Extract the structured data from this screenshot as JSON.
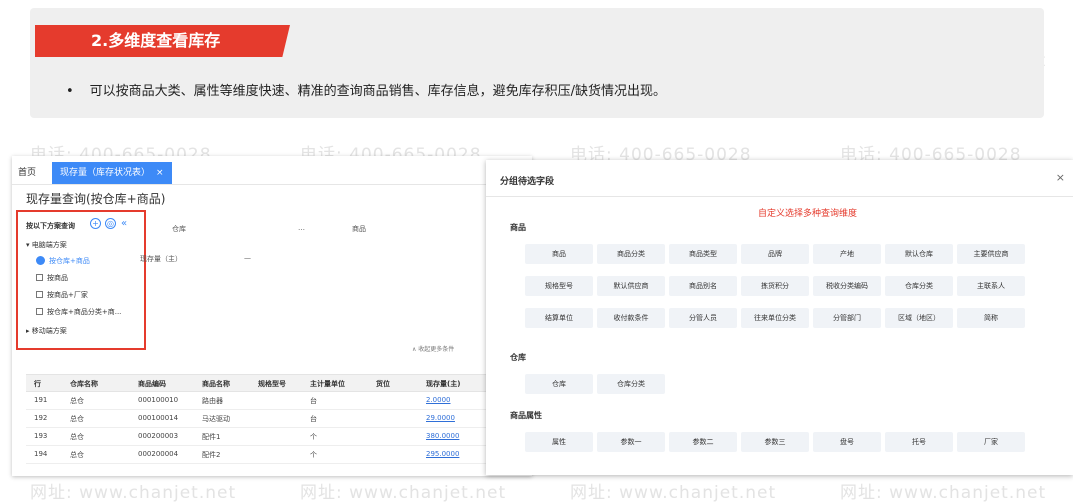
{
  "watermark": {
    "phone": "电话: 400-665-0028",
    "site": "网址: www.chanjet.net"
  },
  "banner": {
    "title": "2.多维度查看库存",
    "bullet": "可以按商品大类、属性等维度快速、精准的查询商品销售、库存信息，避免库存积压/缺货情况出现。"
  },
  "left_window": {
    "tabs": {
      "home": "首页",
      "active": "现存量（库存状况表）",
      "close": "×"
    },
    "page_title": "现存量查询(按仓库+商品)",
    "scheme_panel": {
      "header": "按以下方案查询",
      "group1": "电脑端方案",
      "items": [
        "按仓库+商品",
        "按商品",
        "按商品+厂家",
        "按仓库+商品分类+商..."
      ],
      "group2": "移动端方案"
    },
    "fields": {
      "warehouse": "仓库",
      "product": "商品",
      "stock": "现存量（主）",
      "dash": "—",
      "more": "…"
    },
    "collapse": "∧ 收起更多条件",
    "table": {
      "headers": [
        "行",
        "仓库名称",
        "商品编码",
        "商品名称",
        "规格型号",
        "主计量单位",
        "货位",
        "现存量(主)"
      ],
      "rows": [
        [
          "191",
          "总仓",
          "000100010",
          "路由器",
          "",
          "台",
          "",
          "2.0000"
        ],
        [
          "192",
          "总仓",
          "000100014",
          "马达驱动",
          "",
          "台",
          "",
          "29.0000"
        ],
        [
          "193",
          "总仓",
          "000200003",
          "配件1",
          "",
          "个",
          "",
          "380.0000"
        ],
        [
          "194",
          "总仓",
          "000200004",
          "配件2",
          "",
          "个",
          "",
          "295.0000"
        ]
      ]
    }
  },
  "dialog": {
    "title": "分组待选字段",
    "close": "×",
    "hint": "自定义选择多种查询维度",
    "sections": [
      {
        "name": "商品",
        "chips": [
          "商品",
          "商品分类",
          "商品类型",
          "品牌",
          "产地",
          "默认仓库",
          "主要供应商",
          "规格型号",
          "默认供应商",
          "商品别名",
          "拣货积分",
          "税收分类编码",
          "仓库分类",
          "主联系人",
          "结算单位",
          "收付款条件",
          "分管人员",
          "往来单位分类",
          "分管部门",
          "区域（地区）",
          "简称"
        ]
      },
      {
        "name": "仓库",
        "chips": [
          "仓库",
          "仓库分类"
        ]
      },
      {
        "name": "商品属性",
        "chips": [
          "属性",
          "参数一",
          "参数二",
          "参数三",
          "盘号",
          "托号",
          "厂家"
        ]
      }
    ]
  },
  "colors": {
    "accent_red": "#e53b2d",
    "accent_blue": "#3d8af7"
  }
}
